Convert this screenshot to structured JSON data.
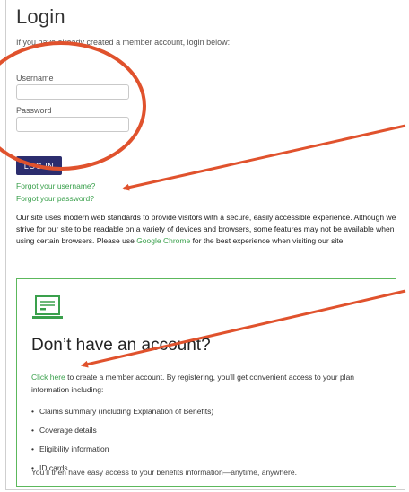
{
  "page": {
    "title": "Login",
    "intro": "If you have already created a member account, login below:"
  },
  "form": {
    "username_label": "Username",
    "username_value": "",
    "password_label": "Password",
    "password_value": "",
    "login_button": "LOG IN",
    "forgot_username": "Forgot your username?",
    "forgot_password": "Forgot your password?"
  },
  "notice": {
    "text_before": "Our site uses modern web standards to provide visitors with a secure, easily accessible experience. Although we strive for our site to be readable on a variety of devices and browsers, some features may not be available when using certain browsers. Please use ",
    "link": "Google Chrome",
    "text_after": " for the best experience when visiting our site."
  },
  "account_box": {
    "icon": "laptop-icon",
    "title": "Don’t have an account?",
    "link": "Click here",
    "text": " to create a member account. By registering, you’ll get convenient access to your plan information including:",
    "bullets": [
      "Claims summary (including Explanation of Benefits)",
      "Coverage details",
      "Eligibility information",
      "ID cards"
    ],
    "closing": "You’ll then have easy access to your benefits information—anytime, anywhere."
  },
  "colors": {
    "brand_navy": "#2c2d6e",
    "link_green": "#3aa04c",
    "box_border": "#5cb85c",
    "annotation_orange": "#e0522d"
  }
}
